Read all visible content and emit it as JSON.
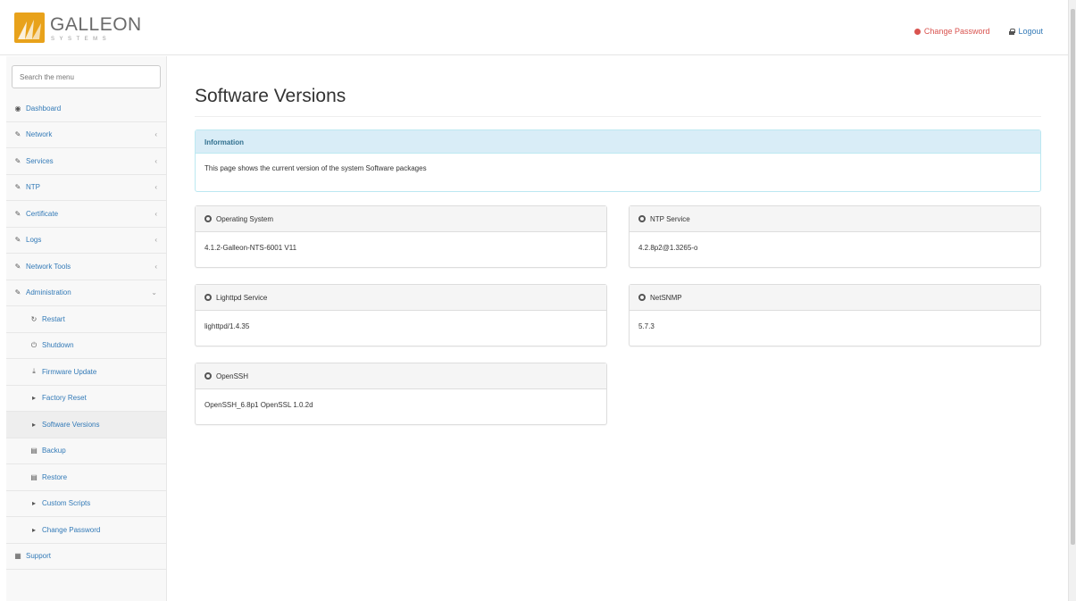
{
  "brand": {
    "name": "GALLEON",
    "sub": "SYSTEMS"
  },
  "header": {
    "change_password": "Change Password",
    "logout": "Logout"
  },
  "sidebar": {
    "search_placeholder": "Search the menu",
    "items": [
      {
        "label": "Dashboard"
      },
      {
        "label": "Network"
      },
      {
        "label": "Services"
      },
      {
        "label": "NTP"
      },
      {
        "label": "Certificate"
      },
      {
        "label": "Logs"
      },
      {
        "label": "Network Tools"
      },
      {
        "label": "Administration"
      },
      {
        "label": "Restart"
      },
      {
        "label": "Shutdown"
      },
      {
        "label": "Firmware Update"
      },
      {
        "label": "Factory Reset"
      },
      {
        "label": "Software Versions"
      },
      {
        "label": "Backup"
      },
      {
        "label": "Restore"
      },
      {
        "label": "Custom Scripts"
      },
      {
        "label": "Change Password"
      },
      {
        "label": "Support"
      }
    ]
  },
  "main": {
    "title": "Software Versions",
    "info": {
      "heading": "Information",
      "text": "This page shows the current version of the system Software packages"
    },
    "panels": [
      {
        "name": "Operating System",
        "value": "4.1.2-Galleon-NTS-6001 V11"
      },
      {
        "name": "NTP Service",
        "value": "4.2.8p2@1.3265-o"
      },
      {
        "name": "Lighttpd Service",
        "value": "lighttpd/1.4.35"
      },
      {
        "name": "NetSNMP",
        "value": "5.7.3"
      },
      {
        "name": "OpenSSH",
        "value": "OpenSSH_6.8p1 OpenSSL 1.0.2d"
      }
    ]
  },
  "colors": {
    "link": "#337ab7",
    "danger": "#d9534f",
    "info_bg": "#d9edf7",
    "brand_orange": "#e8a21b"
  }
}
